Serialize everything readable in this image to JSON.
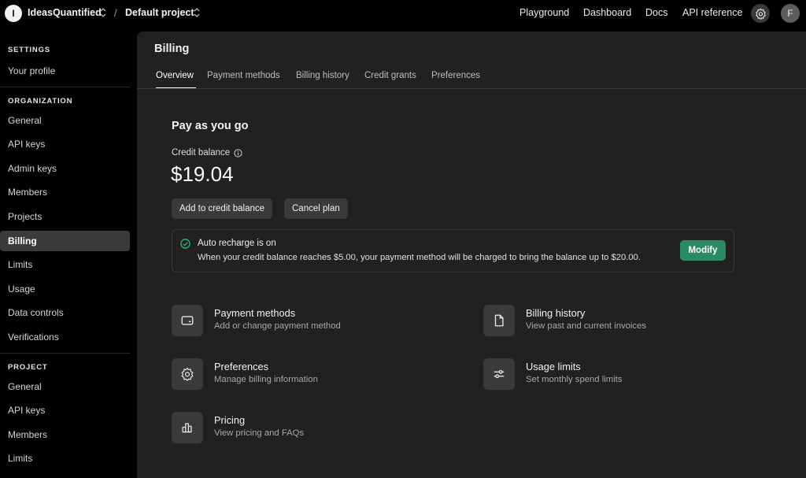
{
  "topbar": {
    "org_initial": "I",
    "org_name": "IdeasQuantified",
    "separator": "/",
    "project_name": "Default project",
    "links": [
      "Playground",
      "Dashboard",
      "Docs",
      "API reference"
    ],
    "user_initial": "F"
  },
  "sidebar": {
    "settings_heading": "SETTINGS",
    "your_profile": "Your profile",
    "organization_heading": "ORGANIZATION",
    "org_items": [
      "General",
      "API keys",
      "Admin keys",
      "Members",
      "Projects",
      "Billing",
      "Limits",
      "Usage",
      "Data controls",
      "Verifications"
    ],
    "project_heading": "PROJECT",
    "project_items": [
      "General",
      "API keys",
      "Members",
      "Limits"
    ]
  },
  "main": {
    "title": "Billing",
    "tabs": [
      "Overview",
      "Payment methods",
      "Billing history",
      "Credit grants",
      "Preferences"
    ],
    "section_title": "Pay as you go",
    "credit_label": "Credit balance",
    "credit_amount": "$19.04",
    "add_credit_label": "Add to credit balance",
    "cancel_plan_label": "Cancel plan",
    "recharge": {
      "title": "Auto recharge is on",
      "description": "When your credit balance reaches $5.00, your payment method will be charged to bring the balance up to $20.00.",
      "modify_label": "Modify"
    },
    "cards": [
      {
        "title": "Payment methods",
        "subtitle": "Add or change payment method",
        "icon": "credit-card-icon"
      },
      {
        "title": "Billing history",
        "subtitle": "View past and current invoices",
        "icon": "document-icon"
      },
      {
        "title": "Preferences",
        "subtitle": "Manage billing information",
        "icon": "gear-icon"
      },
      {
        "title": "Usage limits",
        "subtitle": "Set monthly spend limits",
        "icon": "sliders-icon"
      },
      {
        "title": "Pricing",
        "subtitle": "View pricing and FAQs",
        "icon": "bar-chart-icon"
      }
    ]
  },
  "colors": {
    "background": "#000000",
    "panel": "#212121",
    "accent_green": "#2a8a63",
    "active_sidebar": "#3b3b3e"
  }
}
